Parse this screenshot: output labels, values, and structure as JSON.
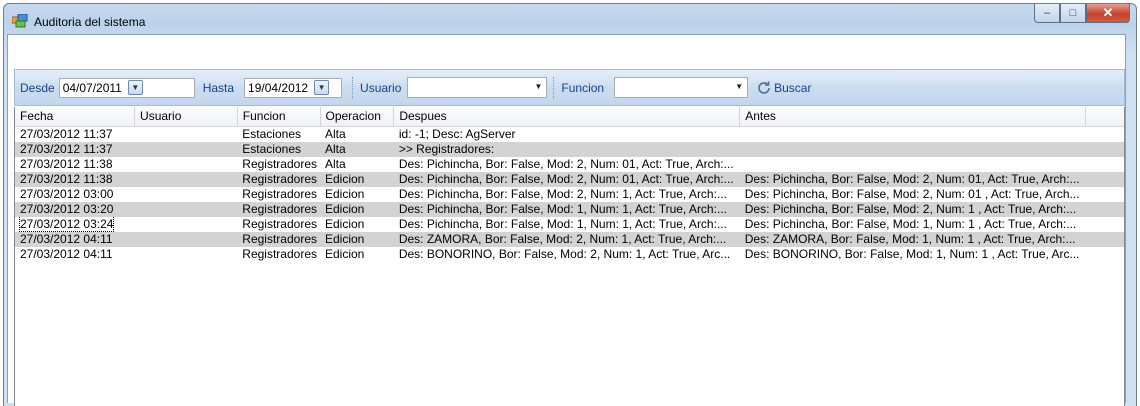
{
  "window": {
    "title": "Auditoria del sistema",
    "controls": {
      "minimize": "–",
      "maximize": "□",
      "close": "✕"
    }
  },
  "toolbar": {
    "desde_label": "Desde",
    "desde_value": "04/07/2011",
    "hasta_label": "Hasta",
    "hasta_value": "19/04/2012",
    "usuario_label": "Usuario",
    "usuario_value": "",
    "funcion_label": "Funcion",
    "funcion_value": "",
    "buscar_label": "Buscar"
  },
  "grid": {
    "columns": [
      "Fecha",
      "Usuario",
      "Funcion",
      "Operacion",
      "Despues",
      "Antes"
    ],
    "rows": [
      {
        "fecha": "27/03/2012 11:37",
        "usuario": "",
        "funcion": "Estaciones",
        "operacion": "Alta",
        "despues": "id: -1; Desc: AgServer",
        "antes": ""
      },
      {
        "fecha": "27/03/2012 11:37",
        "usuario": "",
        "funcion": "Estaciones",
        "operacion": "Alta",
        "despues": ">> Registradores:",
        "antes": ""
      },
      {
        "fecha": "27/03/2012 11:38",
        "usuario": "",
        "funcion": "Registradores",
        "operacion": "Alta",
        "despues": "Des: Pichincha, Bor: False, Mod: 2, Num: 01, Act: True, Arch:...",
        "antes": ""
      },
      {
        "fecha": "27/03/2012 11:38",
        "usuario": "",
        "funcion": "Registradores",
        "operacion": "Edicion",
        "despues": "Des: Pichincha, Bor: False, Mod: 2, Num: 01, Act: True, Arch:...",
        "antes": "Des: Pichincha, Bor: False, Mod: 2, Num: 01, Act: True, Arch:..."
      },
      {
        "fecha": "27/03/2012 03:00",
        "usuario": "",
        "funcion": "Registradores",
        "operacion": "Edicion",
        "despues": "Des: Pichincha, Bor: False, Mod: 2, Num: 1, Act: True, Arch:...",
        "antes": "Des: Pichincha, Bor: False, Mod: 2, Num: 01 , Act: True, Arch..."
      },
      {
        "fecha": "27/03/2012 03:20",
        "usuario": "",
        "funcion": "Registradores",
        "operacion": "Edicion",
        "despues": "Des: Pichincha, Bor: False, Mod: 1, Num: 1, Act: True, Arch:...",
        "antes": "Des: Pichincha, Bor: False, Mod: 2, Num: 1 , Act: True, Arch:..."
      },
      {
        "fecha": "27/03/2012 03:24",
        "usuario": "",
        "funcion": "Registradores",
        "operacion": "Edicion",
        "despues": "Des: Pichincha, Bor: False, Mod: 1, Num: 1, Act: True, Arch:...",
        "antes": "Des: Pichincha, Bor: False, Mod: 1, Num: 1 , Act: True, Arch:..."
      },
      {
        "fecha": "27/03/2012 04:11",
        "usuario": "",
        "funcion": "Registradores",
        "operacion": "Edicion",
        "despues": "Des: ZAMORA, Bor: False, Mod: 2, Num: 1, Act: True, Arch:...",
        "antes": "Des: ZAMORA, Bor: False, Mod: 1, Num: 1 , Act: True, Arch:..."
      },
      {
        "fecha": "27/03/2012 04:11",
        "usuario": "",
        "funcion": "Registradores",
        "operacion": "Edicion",
        "despues": "Des: BONORINO, Bor: False, Mod: 2, Num: 1, Act: True, Arc...",
        "antes": "Des: BONORINO, Bor: False, Mod: 1, Num: 1 , Act: True, Arc..."
      }
    ]
  },
  "colors": {
    "alt_row": "#d3d3d3",
    "toolbar_text": "#15428b",
    "close_button": "#c7432c"
  },
  "icons": [
    "app-icon",
    "calendar-dropdown-icon",
    "combo-dropdown-icon",
    "refresh-icon"
  ]
}
